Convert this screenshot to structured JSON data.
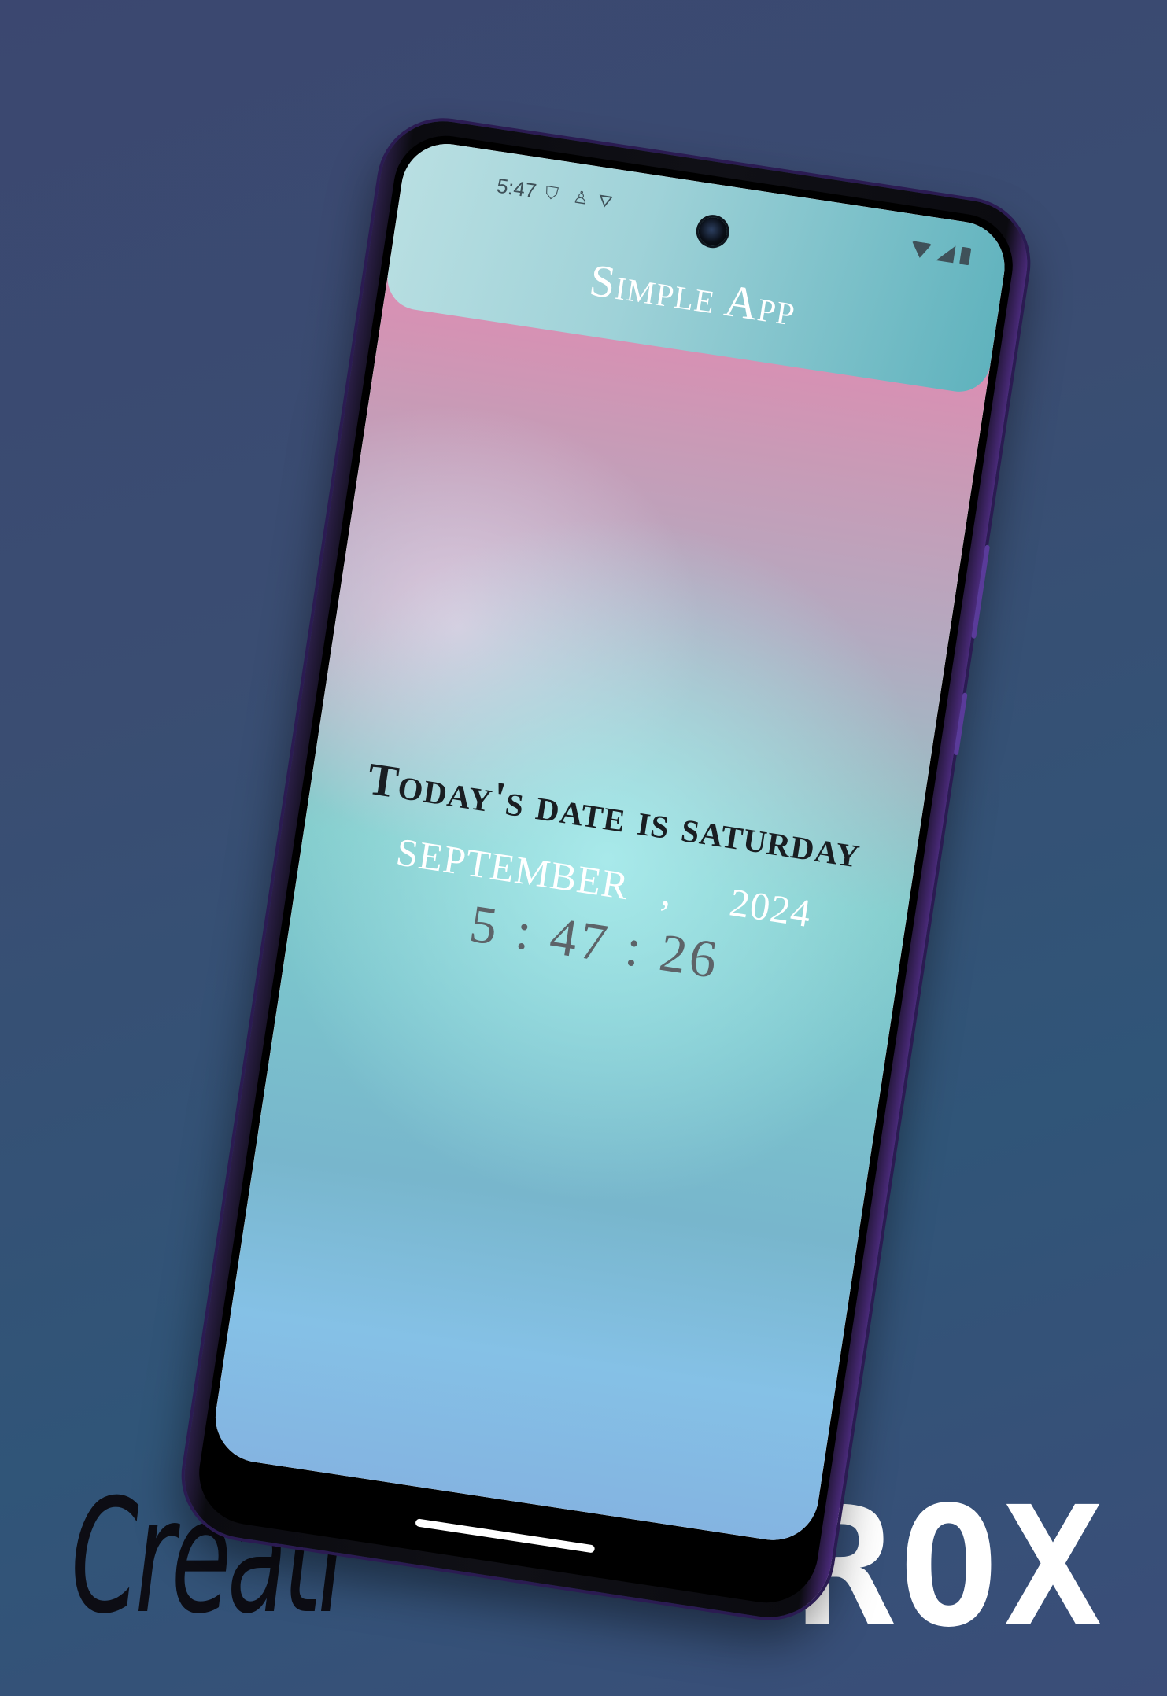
{
  "watermark": {
    "left_text": "Creati",
    "right_text": "ROX"
  },
  "statusbar": {
    "time": "5:47",
    "left_icons": [
      "shield-icon",
      "person-icon",
      "vpn-icon"
    ],
    "right_icons": [
      "wifi-icon",
      "signal-icon",
      "battery-icon"
    ]
  },
  "appbar": {
    "title": "Simple App"
  },
  "content": {
    "date_line1": "Today's date is saturday",
    "month": "SEPTEMBER",
    "comma": ",",
    "year": "2024",
    "time": "5 : 47 : 26"
  },
  "colors": {
    "appbar_gradient": [
      "#b9dfe2",
      "#5fb2bd"
    ],
    "card_top": "#e08bb2",
    "card_mid": "#82cbcb",
    "card_bottom": "#84b4e1",
    "date_text": "#1a1e22",
    "month_year_text": "#ffffff",
    "time_text": "#5d6368"
  }
}
